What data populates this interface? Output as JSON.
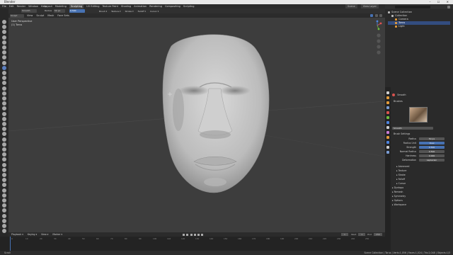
{
  "app": {
    "title": "Blender"
  },
  "titlebar": {
    "window_controls": "– ☐ ✕"
  },
  "menu": [
    "File",
    "Edit",
    "Render",
    "Window",
    "Help"
  ],
  "tabs": [
    {
      "label": "Layout",
      "active": false
    },
    {
      "label": "Modeling",
      "active": false
    },
    {
      "label": "Sculpting",
      "active": true
    },
    {
      "label": "UV Editing",
      "active": false
    },
    {
      "label": "Texture Paint",
      "active": false
    },
    {
      "label": "Shading",
      "active": false
    },
    {
      "label": "Animation",
      "active": false
    },
    {
      "label": "Rendering",
      "active": false
    },
    {
      "label": "Compositing",
      "active": false
    },
    {
      "label": "Scripting",
      "active": false
    }
  ],
  "topright": {
    "scene": "Scene",
    "view_layer": "View Layer"
  },
  "header": {
    "mode": "Sculpt Mode",
    "menus": [
      "View",
      "Sculpt",
      "Mask",
      "Face Sets"
    ],
    "brush": "Smooth",
    "radius_label": "Radius",
    "radius": "50 px",
    "strength_label": "Strength",
    "strength": "0.500",
    "options": [
      "Brush",
      "Texture",
      "Stroke",
      "Falloff",
      "Cursor"
    ]
  },
  "viewport": {
    "perspective": "User Perspective",
    "object": "(1) Torus"
  },
  "gizmo": {
    "x": "X",
    "y": "Y",
    "z": "Z"
  },
  "outliner": {
    "title": "Scene Collection",
    "items": [
      {
        "label": "Scene Collection",
        "indent": 0,
        "selected": false
      },
      {
        "label": "Collection",
        "indent": 1,
        "selected": false
      },
      {
        "label": "Camera",
        "indent": 2,
        "selected": false
      },
      {
        "label": "Torus",
        "indent": 2,
        "selected": true
      },
      {
        "label": "Light",
        "indent": 2,
        "selected": false
      }
    ]
  },
  "properties": {
    "brush_name": "Smooth",
    "brushes_label": "Brushes",
    "brush_field": "Smooth",
    "settings_label": "Brush Settings",
    "rows": [
      {
        "label": "Radius",
        "value": "50 px",
        "blue": false
      },
      {
        "label": "Radius Unit",
        "value": "View",
        "blue": true
      },
      {
        "label": "Strength",
        "value": "0.500",
        "blue": true
      },
      {
        "label": "Normal Radius",
        "value": "0.500",
        "blue": false
      },
      {
        "label": "Hardness",
        "value": "0.000",
        "blue": false
      },
      {
        "label": "Deformation",
        "value": "Laplacian",
        "blue": false
      }
    ],
    "sections": [
      "Advanced",
      "Texture",
      "Stroke",
      "Falloff",
      "Cursor",
      "Dyntopo",
      "Remesh",
      "Symmetry",
      "Options",
      "Workspace"
    ]
  },
  "timeline": {
    "menus": [
      "Playback",
      "Keying",
      "View",
      "Marker"
    ],
    "start_label": "Start",
    "start": "1",
    "end_label": "End",
    "end": "250",
    "current": "1",
    "ticks": [
      "0",
      "10",
      "20",
      "30",
      "40",
      "50",
      "60",
      "70",
      "80",
      "90",
      "100",
      "110",
      "120",
      "130",
      "140",
      "150",
      "160",
      "170",
      "180",
      "190",
      "200",
      "210",
      "220",
      "230",
      "240",
      "250"
    ]
  },
  "status": {
    "left": "Scroll",
    "right": "Scene Collection | Torus | Verts:1,056 | Faces:1,024 | Tris:2,048 | Objects:1/3"
  },
  "colors": {
    "accent": "#4772b3",
    "viewport": "#3d3d3d",
    "mesh": "#c8c8c8"
  }
}
